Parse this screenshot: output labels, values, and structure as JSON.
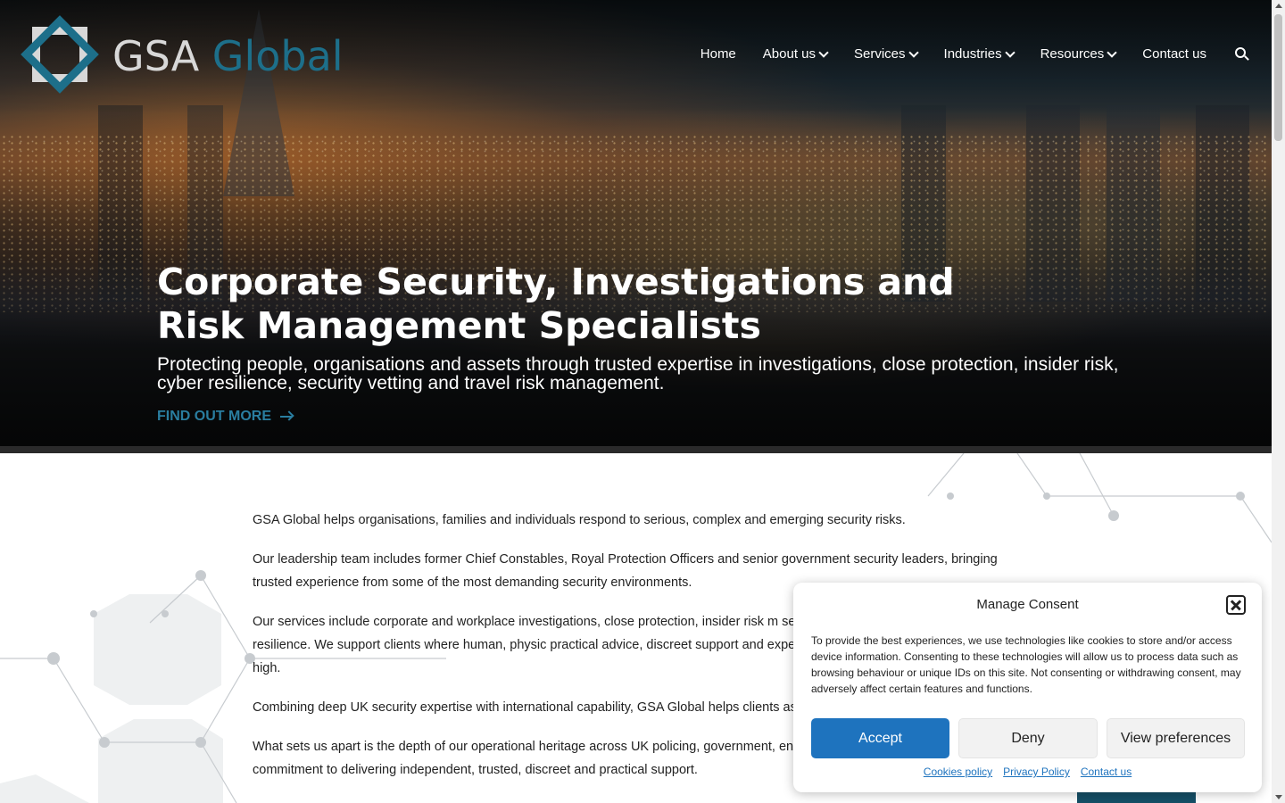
{
  "brand": {
    "name_part1": "GSA",
    "name_part2": "Global",
    "accent_color": "#1d6f8a"
  },
  "nav": {
    "items": [
      {
        "label": "Home",
        "has_dropdown": false
      },
      {
        "label": "About us",
        "has_dropdown": true
      },
      {
        "label": "Services",
        "has_dropdown": true
      },
      {
        "label": "Industries",
        "has_dropdown": true
      },
      {
        "label": "Resources",
        "has_dropdown": true
      },
      {
        "label": "Contact us",
        "has_dropdown": false
      }
    ],
    "search_icon": "search-icon"
  },
  "hero": {
    "title": "Corporate Security, Investigations and Risk Management Specialists",
    "subtitle": "Protecting people, organisations and assets through trusted expertise in investigations, close protection, insider risk, cyber resilience, security vetting and travel risk management.",
    "cta_label": "FIND OUT MORE"
  },
  "content": {
    "paragraphs": [
      "GSA Global helps organisations, families and individuals respond to serious, complex and emerging security risks.",
      "Our leadership team includes former Chief Constables, Royal Protection Officers and senior government security leaders, bringing trusted experience from some of the most demanding security environments.",
      "Our services include corporate and workplace investigations, close protection, insider risk m security vetting, due diligence and cyber resilience. We support clients where human, physic practical advice, discreet support and experienced judgement when the stakes are high.",
      "Combining deep UK security expertise with international capability, GSA Global helps clients assets and reputations.",
      "What sets us apart is the depth of our operational heritage across UK policing, government, environments, together with a shared commitment to delivering independent, trusted, discreet and practical support."
    ]
  },
  "consent": {
    "title": "Manage Consent",
    "body": "To provide the best experiences, we use technologies like cookies to store and/or access device information. Consenting to these technologies will allow us to process data such as browsing behaviour or unique IDs on this site. Not consenting or withdrawing consent, may adversely affect certain features and functions.",
    "accept_label": "Accept",
    "deny_label": "Deny",
    "preferences_label": "View preferences",
    "links": [
      "Cookies policy",
      "Privacy Policy",
      "Contact us"
    ],
    "accept_color": "#1e73be"
  }
}
